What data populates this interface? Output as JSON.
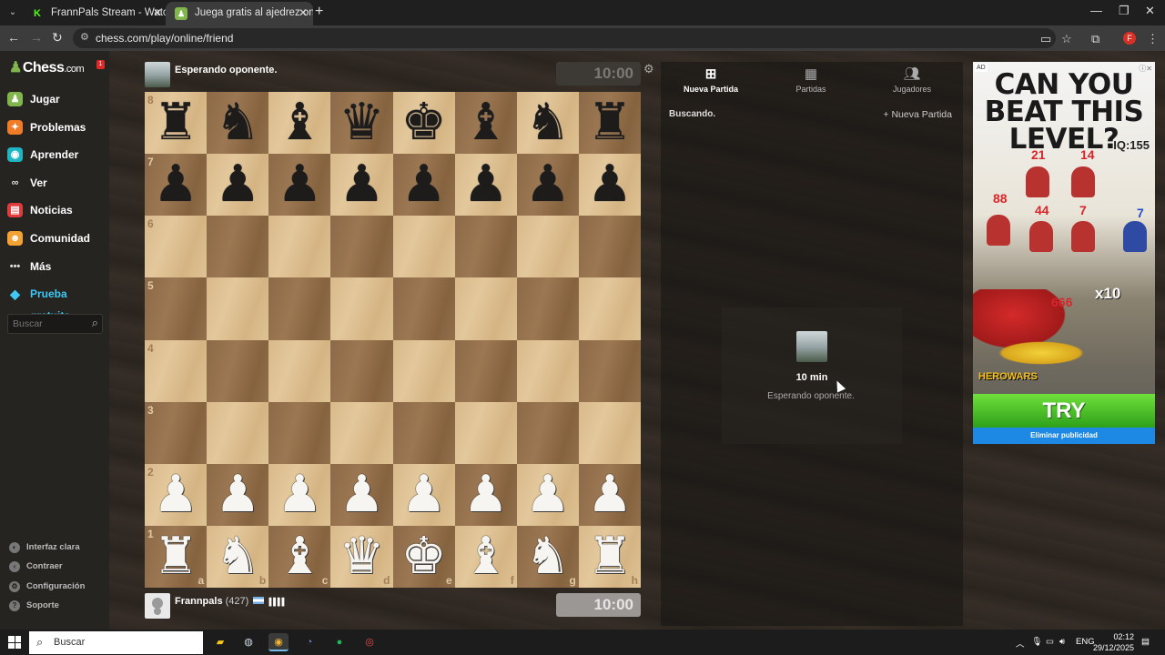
{
  "browser": {
    "tabs": [
      {
        "title": "FrannPals Stream - Watch Live o",
        "active": false
      },
      {
        "title": "Juega gratis al ajedrez online co",
        "active": true
      }
    ],
    "url": "chess.com/play/online/friend",
    "profile_initial": "F"
  },
  "sidebar": {
    "logo": "Chess",
    "logo_suffix": ".com",
    "notification_count": "1",
    "items": [
      {
        "label": "Jugar",
        "icon": "pawn-icon",
        "color": "#81b64c"
      },
      {
        "label": "Problemas",
        "icon": "puzzle-icon",
        "color": "#f17c28"
      },
      {
        "label": "Aprender",
        "icon": "learn-icon",
        "color": "#1fb5c2"
      },
      {
        "label": "Ver",
        "icon": "binoculars-icon",
        "color": "#cfcfcf"
      },
      {
        "label": "Noticias",
        "icon": "news-icon",
        "color": "#e33b3b"
      },
      {
        "label": "Comunidad",
        "icon": "community-icon",
        "color": "#f3a233"
      },
      {
        "label": "Más",
        "icon": "more-icon",
        "color": "#cfcfcf"
      },
      {
        "label": "Prueba gratuita",
        "icon": "diamond-icon",
        "color": "#3ec9f5"
      }
    ],
    "search_placeholder": "Buscar",
    "footer": [
      {
        "label": "Interfaz clara",
        "icon": "half-circle-icon"
      },
      {
        "label": "Contraer",
        "icon": "collapse-icon"
      },
      {
        "label": "Configuración",
        "icon": "gear-icon"
      },
      {
        "label": "Soporte",
        "icon": "help-icon"
      }
    ]
  },
  "game": {
    "opponent": {
      "status": "Esperando oponente.",
      "clock": "10:00"
    },
    "player": {
      "name": "Frannpals",
      "rating": "(427)",
      "bars": "▌▌▌▌",
      "clock": "10:00"
    },
    "board": {
      "rows": [
        [
          "♜",
          "♞",
          "♝",
          "♛",
          "♚",
          "♝",
          "♞",
          "♜"
        ],
        [
          "♟",
          "♟",
          "♟",
          "♟",
          "♟",
          "♟",
          "♟",
          "♟"
        ],
        [
          "",
          "",
          "",
          "",
          "",
          "",
          "",
          ""
        ],
        [
          "",
          "",
          "",
          "",
          "",
          "",
          "",
          ""
        ],
        [
          "",
          "",
          "",
          "",
          "",
          "",
          "",
          ""
        ],
        [
          "",
          "",
          "",
          "",
          "",
          "",
          "",
          ""
        ],
        [
          "♟",
          "♟",
          "♟",
          "♟",
          "♟",
          "♟",
          "♟",
          "♟"
        ],
        [
          "♜",
          "♞",
          "♝",
          "♛",
          "♚",
          "♝",
          "♞",
          "♜"
        ]
      ],
      "ranks": [
        "8",
        "7",
        "6",
        "5",
        "4",
        "3",
        "2",
        "1"
      ],
      "files": [
        "a",
        "b",
        "c",
        "d",
        "e",
        "f",
        "g",
        "h"
      ]
    }
  },
  "panel": {
    "tabs": [
      {
        "label": "Nueva Partida",
        "icon": "plus-square-icon",
        "active": true
      },
      {
        "label": "Partidas",
        "icon": "board-icon",
        "active": false
      },
      {
        "label": "Jugadores",
        "icon": "players-icon",
        "active": false
      }
    ],
    "searching": "Buscando.",
    "new_game_link": "Nueva Partida",
    "waiting": {
      "time": "10 min",
      "status": "Esperando oponente."
    }
  },
  "ad": {
    "label": "AD",
    "headline": "CAN YOU BEAT THIS LEVEL?",
    "iq": "IQ:155",
    "numbers": [
      "21",
      "14",
      "88",
      "44",
      "7",
      "7",
      "666",
      "x10"
    ],
    "brand": "HEROWARS",
    "cta": "TRY",
    "remove": "Eliminar publicidad"
  },
  "taskbar": {
    "search_placeholder": "Buscar",
    "language": "ENG",
    "time": "02:12",
    "date": "29/12/2025"
  }
}
